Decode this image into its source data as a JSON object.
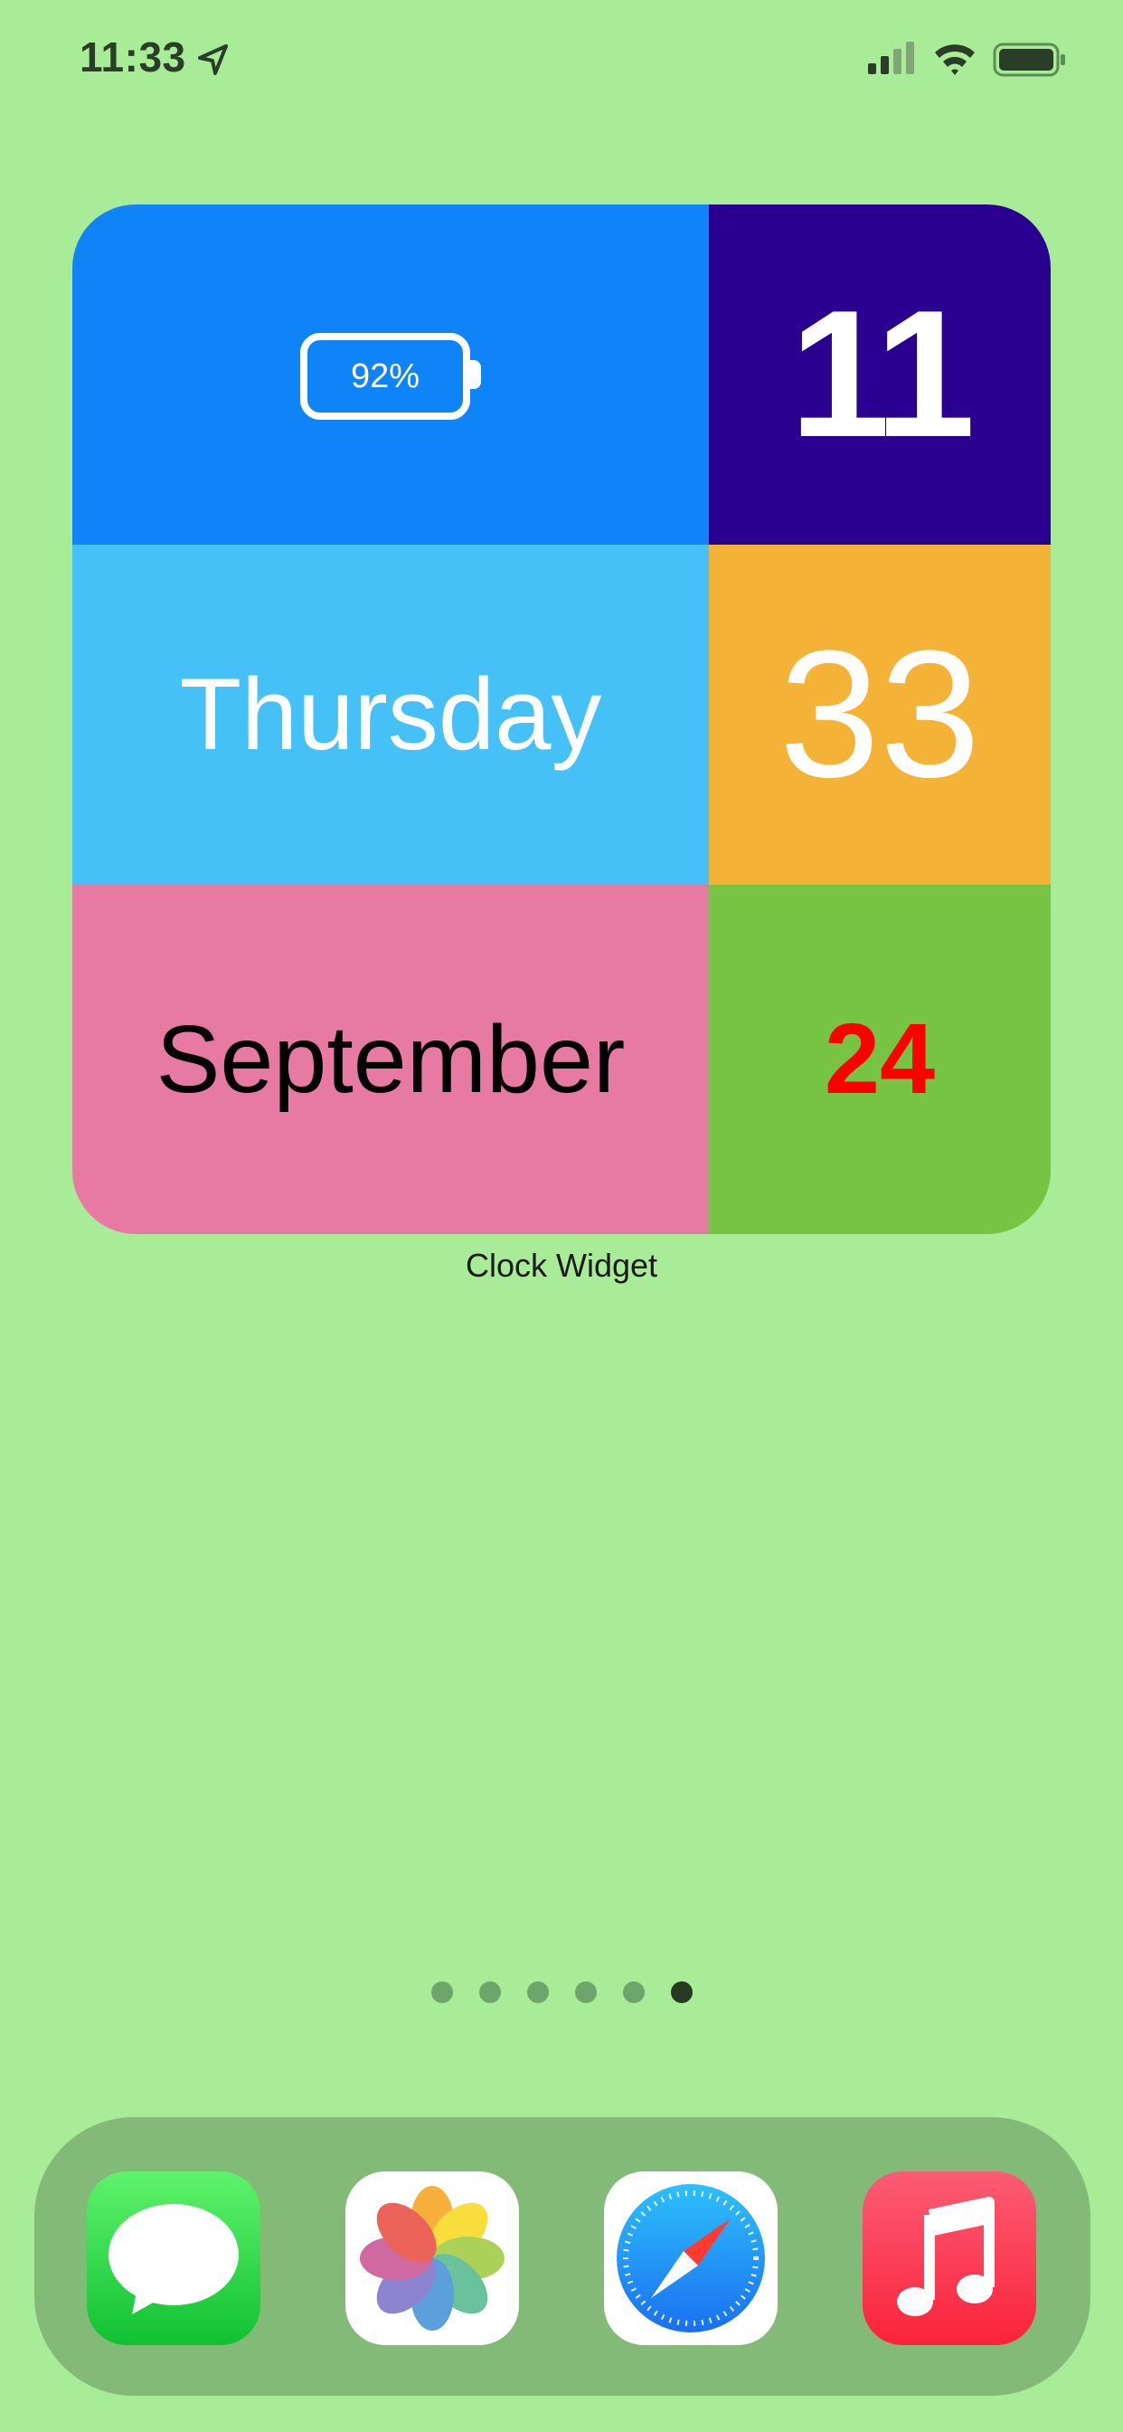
{
  "status_bar": {
    "time": "11:33"
  },
  "widget": {
    "battery_percent": "92%",
    "hour": "11",
    "minute": "33",
    "weekday": "Thursday",
    "month": "September",
    "day": "24",
    "label": "Clock Widget"
  },
  "page_dots": {
    "count": 6,
    "active_index": 5
  },
  "dock": {
    "apps": [
      {
        "name": "Messages",
        "icon": "messages-icon"
      },
      {
        "name": "Photos",
        "icon": "photos-icon"
      },
      {
        "name": "Safari",
        "icon": "safari-icon"
      },
      {
        "name": "Music",
        "icon": "music-icon"
      }
    ]
  },
  "colors": {
    "wallpaper": "#a8ec98",
    "battery_cell": "#0f84f9",
    "hour_cell": "#2a0090",
    "weekday_cell": "#45c1f7",
    "minute_cell": "#f4b337",
    "month_cell": "#e77aa2",
    "day_cell": "#77c444",
    "day_text": "#ff0000"
  }
}
